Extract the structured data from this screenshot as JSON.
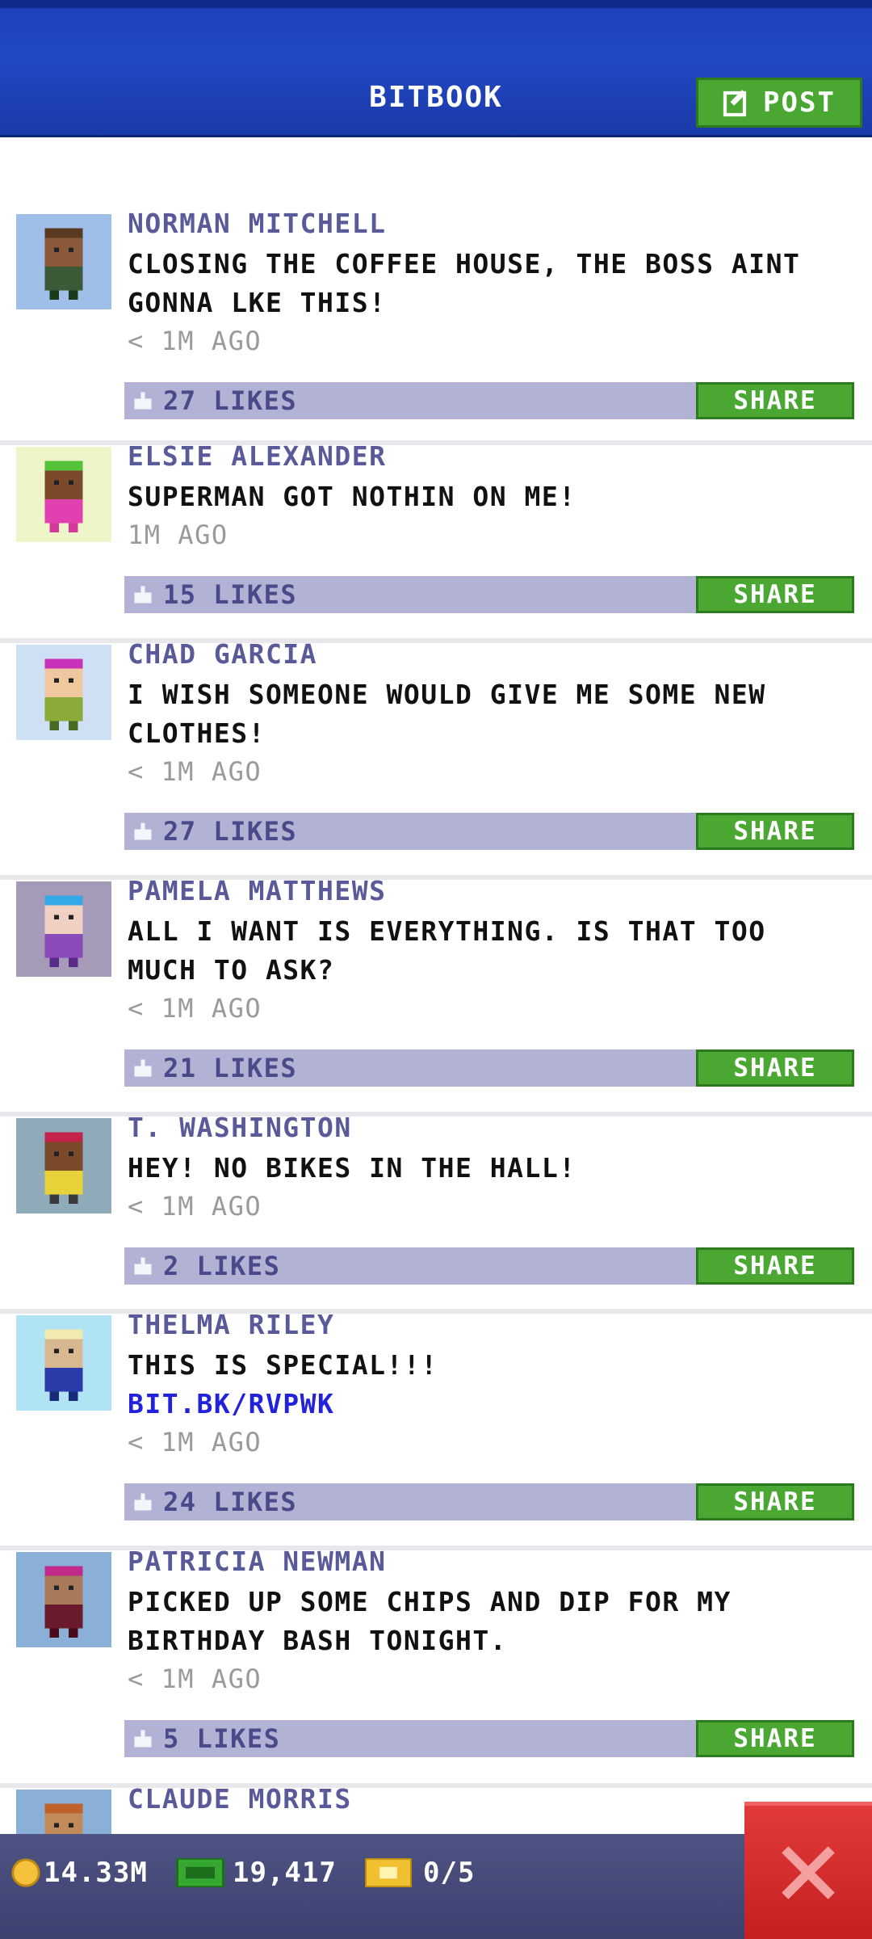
{
  "header": {
    "title": "BITBOOK",
    "post_label": "POST"
  },
  "posts": [
    {
      "name": "NORMAN MITCHELL",
      "lines": [
        "CLOSING THE COFFEE HOUSE, THE BOSS AINT",
        "GONNA LKE THIS!"
      ],
      "link": "",
      "time": "< 1M AGO",
      "likes": "27 LIKES",
      "share": "SHARE"
    },
    {
      "name": "ELSIE ALEXANDER",
      "lines": [
        "SUPERMAN GOT NOTHIN ON ME!"
      ],
      "link": "",
      "time": "1M AGO",
      "likes": "15 LIKES",
      "share": "SHARE"
    },
    {
      "name": "CHAD GARCIA",
      "lines": [
        "I WISH SOMEONE WOULD GIVE ME SOME NEW",
        "CLOTHES!"
      ],
      "link": "",
      "time": "< 1M AGO",
      "likes": "27 LIKES",
      "share": "SHARE"
    },
    {
      "name": "PAMELA MATTHEWS",
      "lines": [
        "ALL I WANT IS EVERYTHING. IS THAT TOO",
        "MUCH TO ASK?"
      ],
      "link": "",
      "time": "< 1M AGO",
      "likes": "21 LIKES",
      "share": "SHARE"
    },
    {
      "name": "T. WASHINGTON",
      "lines": [
        "HEY! NO BIKES IN THE HALL!"
      ],
      "link": "",
      "time": "< 1M AGO",
      "likes": "2 LIKES",
      "share": "SHARE"
    },
    {
      "name": "THELMA RILEY",
      "lines": [
        "THIS IS SPECIAL!!!"
      ],
      "link": "BIT.BK/RVPWK",
      "time": "< 1M AGO",
      "likes": "24 LIKES",
      "share": "SHARE"
    },
    {
      "name": "PATRICIA NEWMAN",
      "lines": [
        "PICKED UP SOME CHIPS AND DIP FOR MY",
        "BIRTHDAY BASH TONIGHT."
      ],
      "link": "",
      "time": "< 1M AGO",
      "likes": "5 LIKES",
      "share": "SHARE"
    },
    {
      "name": "CLAUDE MORRIS",
      "lines": [],
      "link": "",
      "time": "",
      "likes": "",
      "share": ""
    }
  ],
  "stats": {
    "coins": "14.33M",
    "bux": "19,417",
    "tickets": "0/5"
  },
  "colors": {
    "header_blue": "#1e40b8",
    "share_green": "#4aa832",
    "likes_bar": "#b2b3d4",
    "close_red": "#d42a2a"
  },
  "icons": {
    "post": "edit-icon",
    "likes": "thumb-icon",
    "coins": "coin-icon",
    "bux": "bux-icon",
    "tickets": "ticket-icon",
    "close": "close-icon"
  }
}
